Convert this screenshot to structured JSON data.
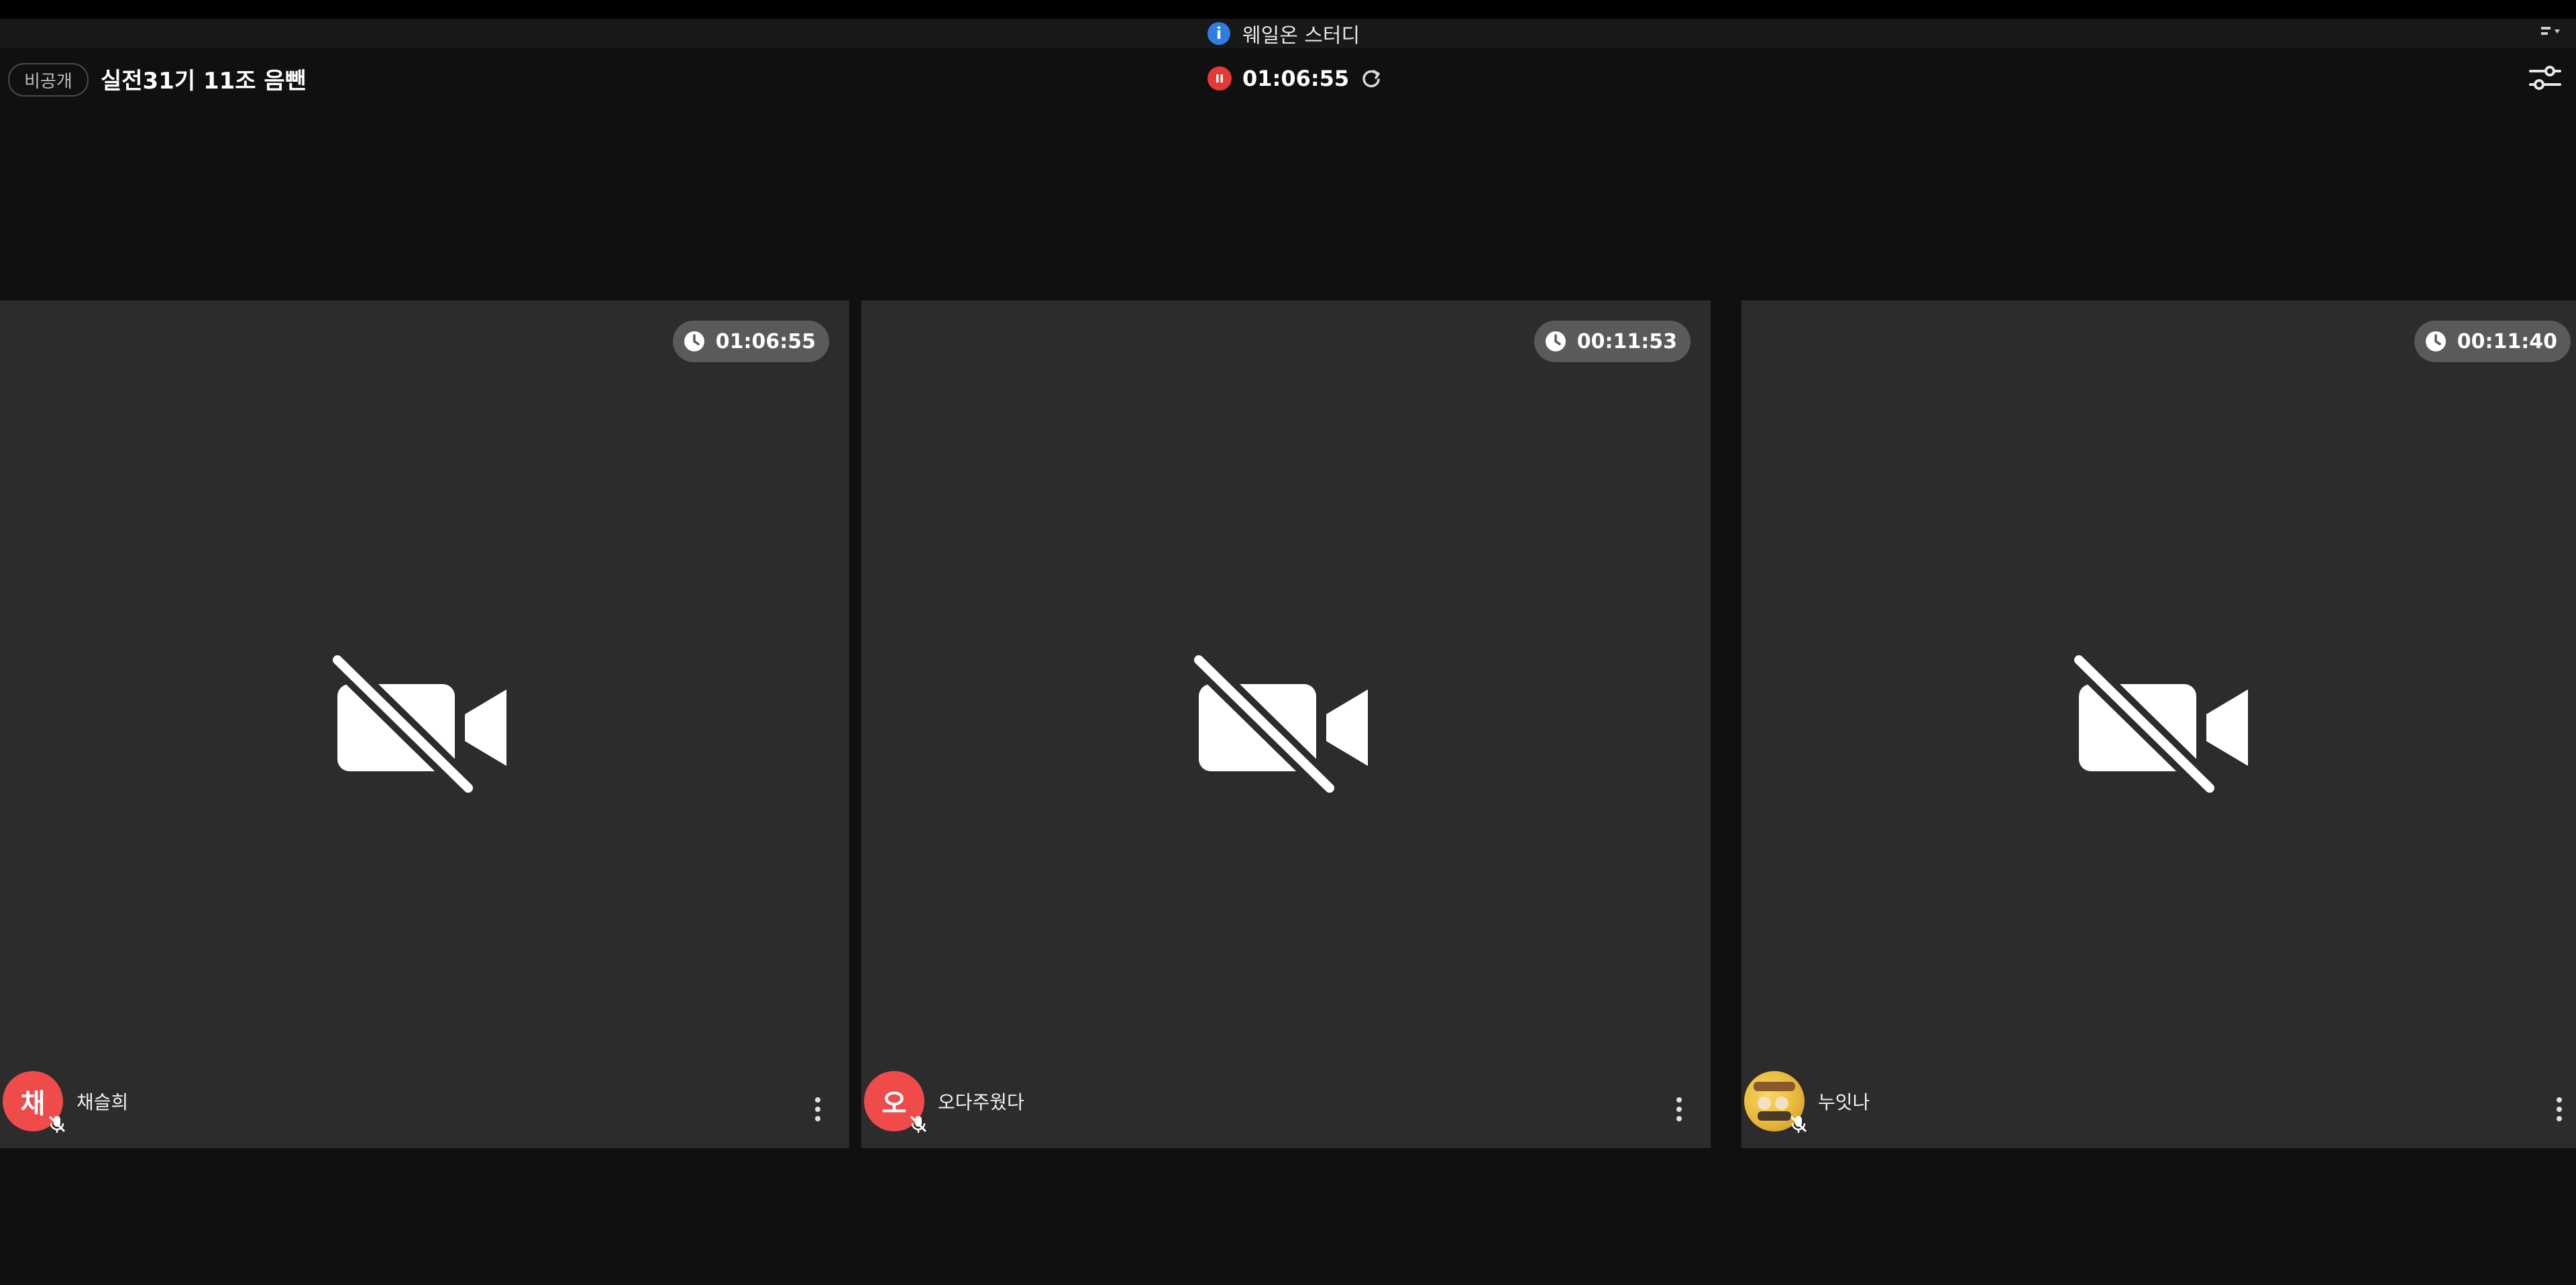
{
  "banner": {
    "info_glyph": "i",
    "text": "웨일온 스터디"
  },
  "header": {
    "privacy_label": "비공개",
    "room_title": "실전31기 11조 음뺀",
    "recording_time": "01:06:55"
  },
  "tiles": [
    {
      "timer": "01:06:55",
      "avatar_initial": "채",
      "name": "채슬희",
      "avatar_type": "initial"
    },
    {
      "timer": "00:11:53",
      "avatar_initial": "오",
      "name": "오다주웠다",
      "avatar_type": "initial"
    },
    {
      "timer": "00:11:40",
      "avatar_initial": "",
      "name": "누잇나",
      "avatar_type": "image"
    }
  ],
  "icons": {
    "recording": "record-stop-icon",
    "refresh": "refresh-icon",
    "settings": "settings-sliders-icon",
    "timer": "clock-icon",
    "camera_off": "video-off-icon",
    "mic_off": "mic-off-icon",
    "more": "more-vertical-icon"
  },
  "colors": {
    "background": "#101010",
    "tile": "#2c2c2c",
    "avatar": "#ef4b4b",
    "recording": "#e53935",
    "info": "#2f7de1"
  }
}
